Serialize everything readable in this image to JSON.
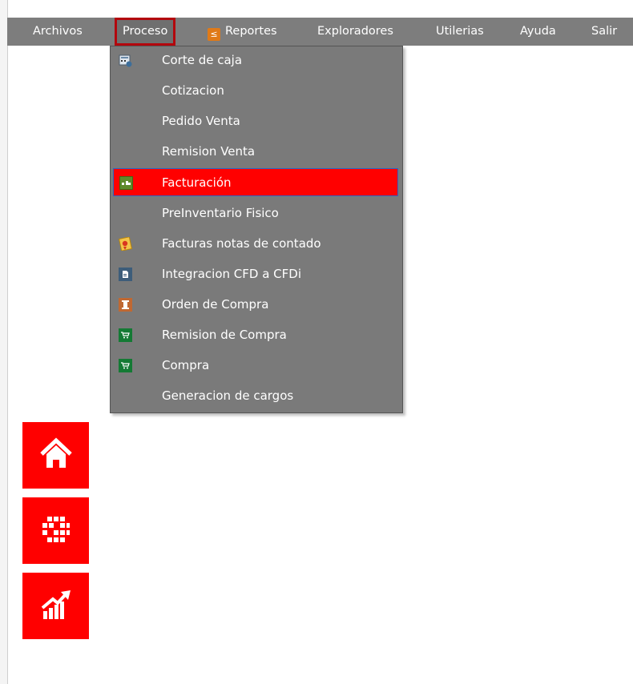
{
  "menubar": {
    "items": [
      {
        "label": "Archivos"
      },
      {
        "label": "Proceso"
      },
      {
        "label": "Reportes"
      },
      {
        "label": "Exploradores"
      },
      {
        "label": "Utilerias"
      },
      {
        "label": "Ayuda"
      },
      {
        "label": "Salir"
      }
    ],
    "active": "Proceso"
  },
  "proceso_menu": {
    "items": [
      {
        "label": "Corte de caja",
        "icon": "calculator-icon"
      },
      {
        "label": "Cotizacion",
        "icon": ""
      },
      {
        "label": "Pedido Venta",
        "icon": ""
      },
      {
        "label": "Remision Venta",
        "icon": ""
      },
      {
        "label": "Facturación",
        "icon": "invoice-icon"
      },
      {
        "label": "PreInventario Fisico",
        "icon": ""
      },
      {
        "label": "Facturas notas de contado",
        "icon": "certificate-icon"
      },
      {
        "label": "Integracion CFD a CFDi",
        "icon": "document-icon"
      },
      {
        "label": "Orden de Compra",
        "icon": "order-icon"
      },
      {
        "label": "Remision de Compra",
        "icon": "cart-icon"
      },
      {
        "label": "Compra",
        "icon": "cart-icon"
      },
      {
        "label": "Generacion de cargos",
        "icon": ""
      }
    ],
    "highlighted": "Facturación"
  },
  "sidebar": {
    "buttons": [
      {
        "icon": "home-icon"
      },
      {
        "icon": "grid-icon"
      },
      {
        "icon": "growth-chart-icon"
      }
    ]
  },
  "colors": {
    "menubar_bg": "#7d7d7d",
    "dropdown_bg": "#7a7a7a",
    "highlight": "#ff0000",
    "active_outline": "#b3070d",
    "sidebar_button": "#ff0000"
  }
}
